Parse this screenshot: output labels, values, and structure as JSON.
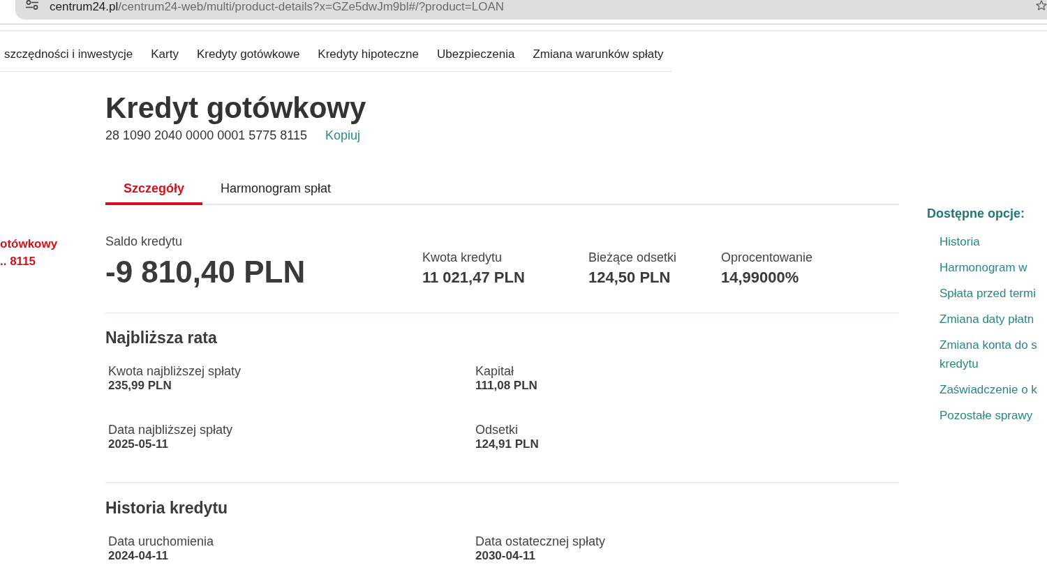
{
  "address_bar": {
    "host": "centrum24.pl",
    "path": "/centrum24-web/multi/product-details?x=GZe5dwJm9bl#/?product=LOAN"
  },
  "top_nav": [
    "szczędności i inwestycje",
    "Karty",
    "Kredyty gotówkowe",
    "Kredyty hipoteczne",
    "Ubezpieczenia",
    "Zmiana warunków spłaty"
  ],
  "products": [
    {
      "name": "otówkowy",
      "number": ".. 8115",
      "selected": true
    }
  ],
  "product": {
    "title": "Kredyt gotówkowy",
    "account_number": "28 1090 2040 0000 0001 5775 8115",
    "copy_label": "Kopiuj"
  },
  "tabs": [
    {
      "label": "Szczegóły",
      "selected": true
    },
    {
      "label": "Harmonogram spłat",
      "selected": false
    }
  ],
  "balance": {
    "label": "Saldo kredytu",
    "value": "-9 810,40 PLN"
  },
  "summary": [
    {
      "label": "Kwota kredytu",
      "value": "11 021,47 PLN"
    },
    {
      "label": "Bieżące odsetki",
      "value": "124,50 PLN"
    },
    {
      "label": "Oprocentowanie",
      "value": "14,99000%"
    }
  ],
  "sections": [
    {
      "title": "Najbliższa rata",
      "fields": [
        {
          "label": "Kwota najbliższej spłaty",
          "value": "235,99 PLN"
        },
        {
          "label": "Kapitał",
          "value": "111,08 PLN"
        },
        {
          "label": "Data najbliższej spłaty",
          "value": "2025-05-11"
        },
        {
          "label": "Odsetki",
          "value": "124,91 PLN"
        }
      ]
    },
    {
      "title": "Historia kredytu",
      "fields": [
        {
          "label": "Data uruchomienia",
          "value": "2024-04-11"
        },
        {
          "label": "Data ostatecznej spłaty",
          "value": "2030-04-11"
        }
      ]
    }
  ],
  "options": {
    "title": "Dostępne opcje:",
    "items": [
      "Historia",
      "Harmonogram w",
      "Spłata przed termi",
      "Zmiana daty płatn",
      "Zmiana konta do s kredytu",
      "Zaświadczenie o k",
      "Pozostałe sprawy"
    ]
  }
}
